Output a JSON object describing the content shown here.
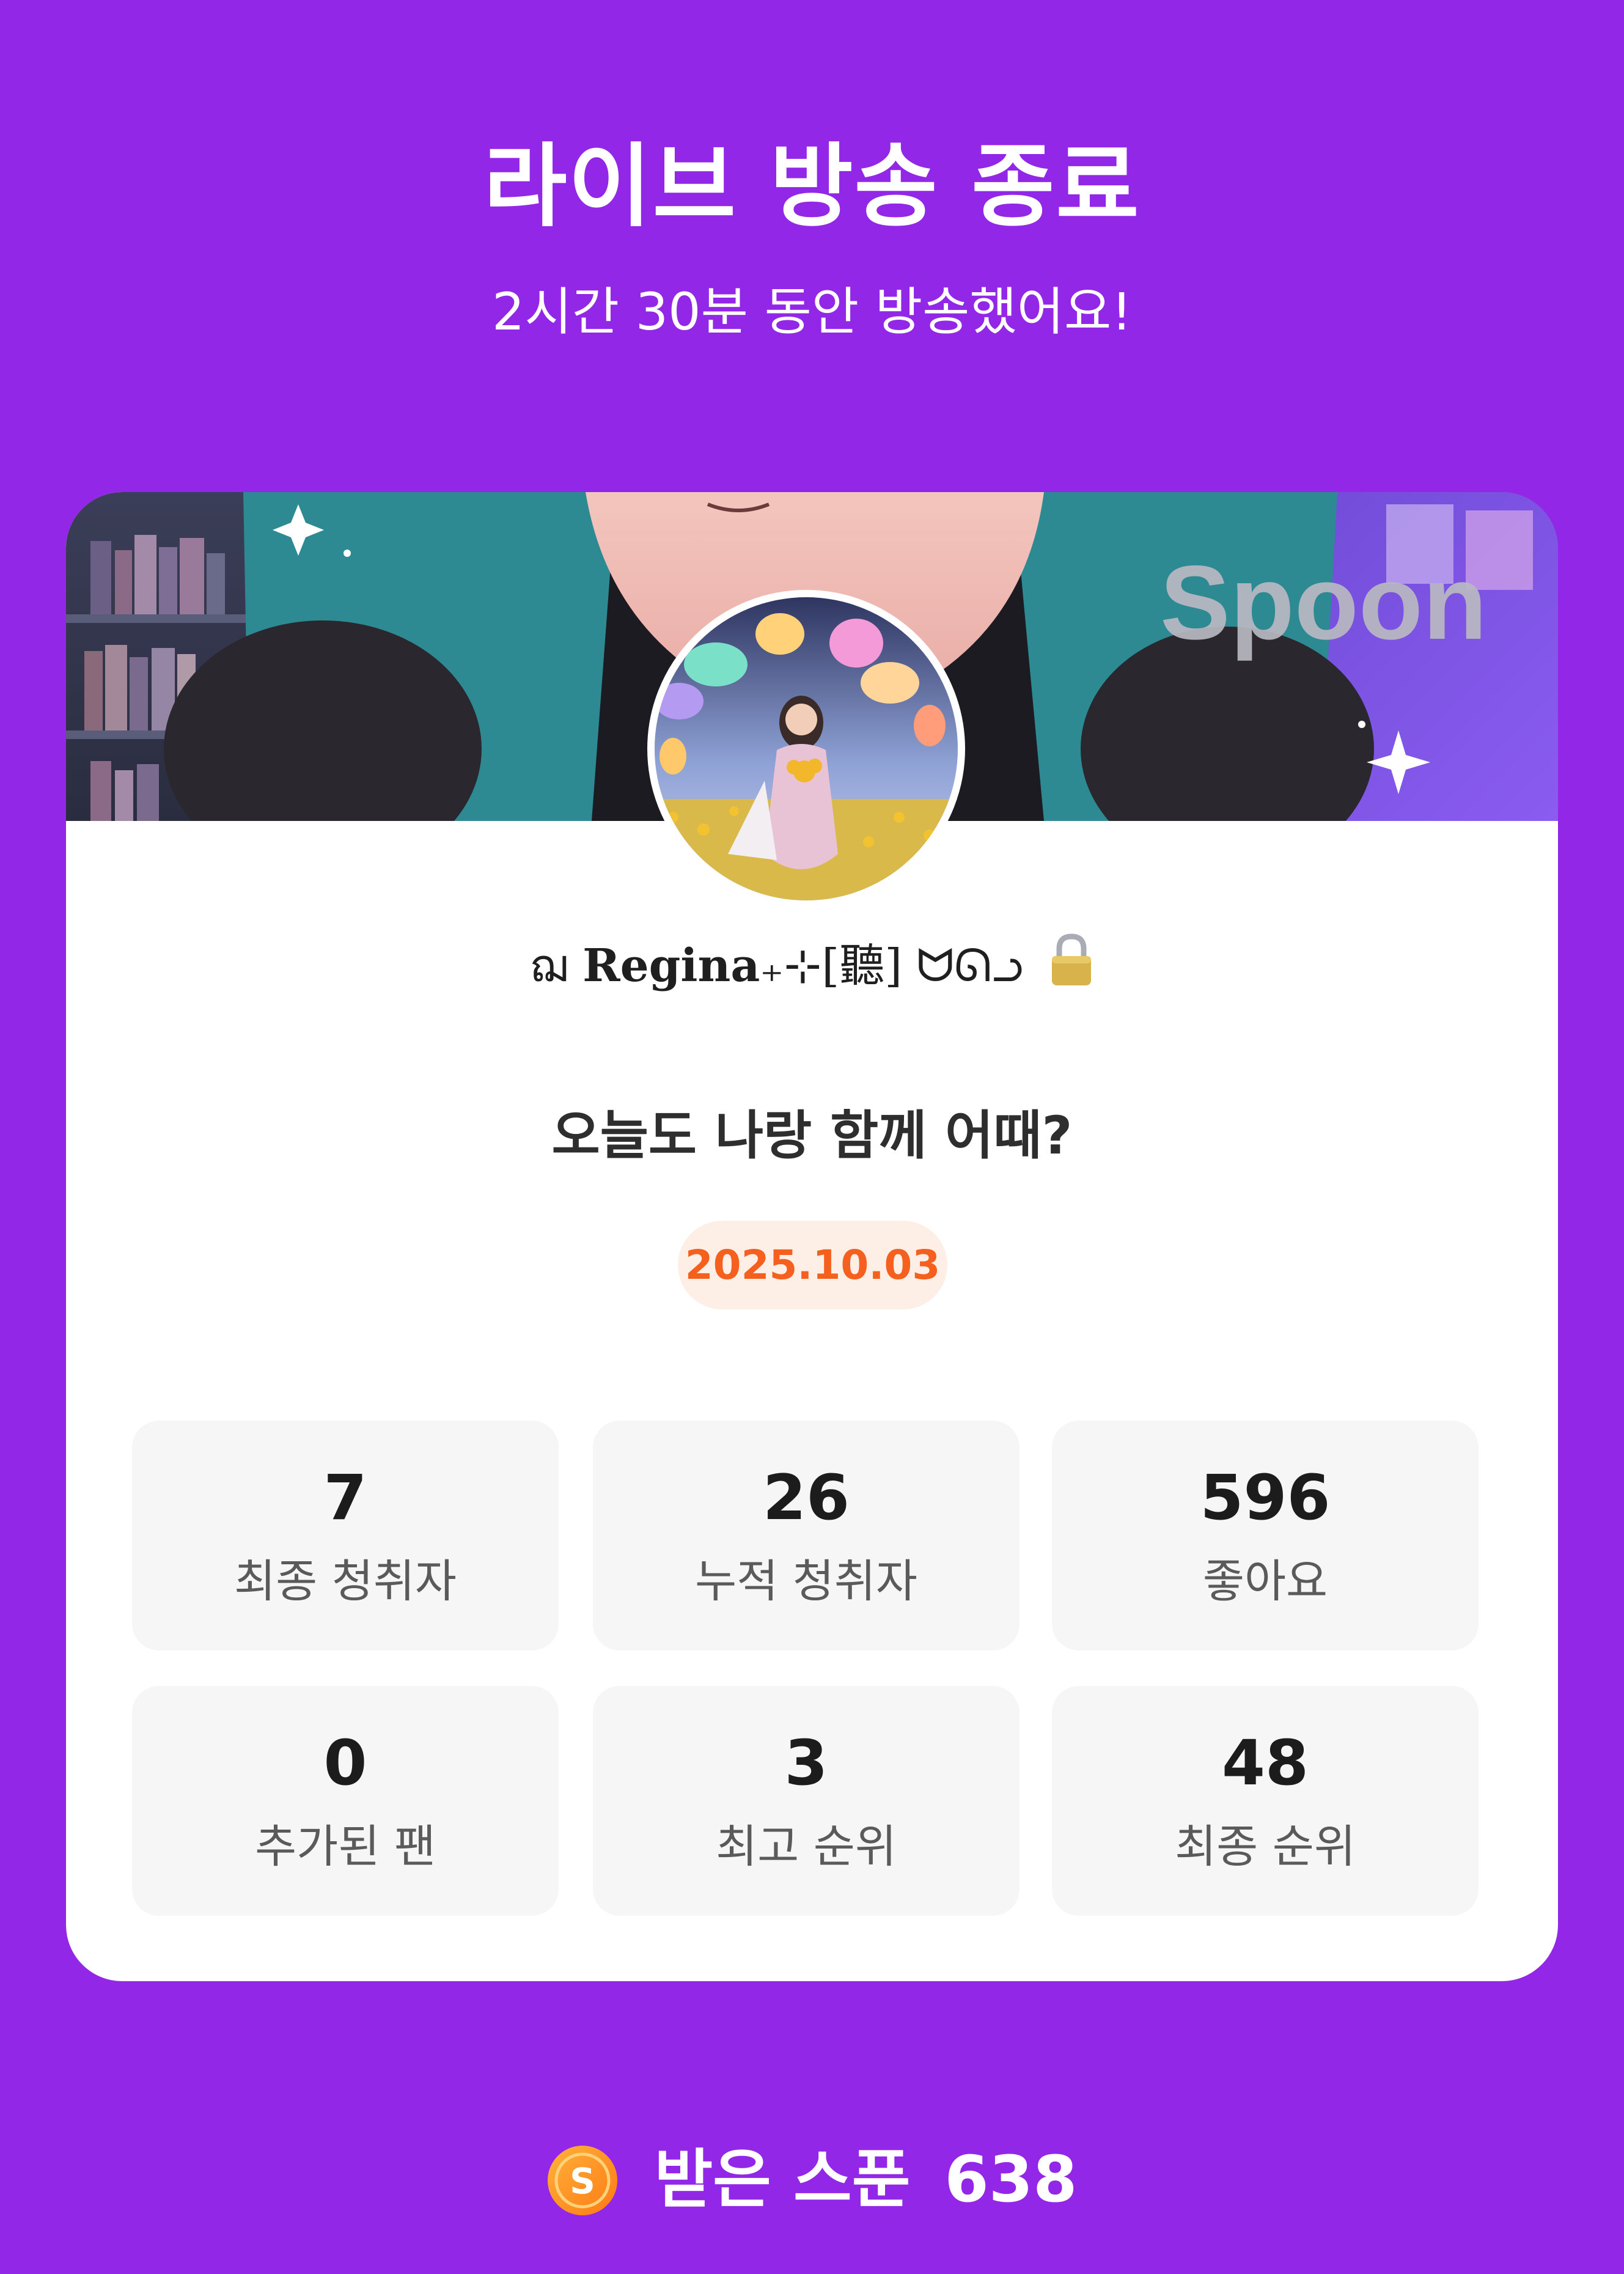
{
  "header": {
    "title": "라이브 방송 종료",
    "subtitle": "2시간 30분 동안 방송했어요!"
  },
  "card": {
    "banner_logo": "Spoon",
    "nickname_prefix": "ฌ ",
    "nickname_main": "Regina",
    "nickname_suffix": "₊⊹[聽] ᗢᘏᓗ",
    "lock_icon": "lock-icon",
    "stream_title": "오늘도 나랑 함께 어때?",
    "date": "2025.10.03",
    "date_color": "#f5601e"
  },
  "stats": [
    {
      "value": "7",
      "label": "최종 청취자"
    },
    {
      "value": "26",
      "label": "누적 청취자"
    },
    {
      "value": "596",
      "label": "좋아요"
    },
    {
      "value": "0",
      "label": "추가된 팬"
    },
    {
      "value": "3",
      "label": "최고 순위"
    },
    {
      "value": "48",
      "label": "최종 순위"
    }
  ],
  "footer": {
    "coin_icon": "spoon-coin-icon",
    "label": "받은 스푼",
    "value": "638"
  },
  "colors": {
    "background": "#9327e8",
    "card": "#ffffff",
    "stat_tile": "#f6f6f6",
    "accent_orange": "#f5601e"
  }
}
